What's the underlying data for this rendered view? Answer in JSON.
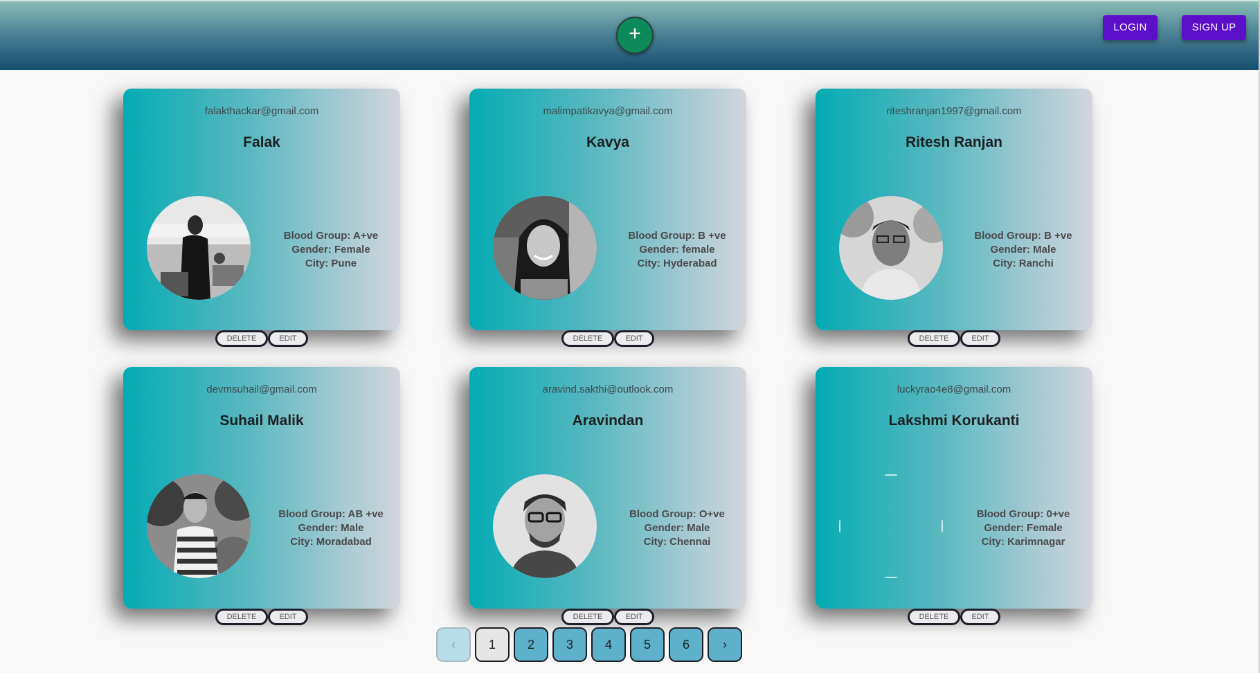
{
  "header": {
    "add_icon": "plus-icon",
    "add_label": "+",
    "login_label": "LOGIN",
    "signup_label": "SIGN UP",
    "colors": {
      "add": "#0d8a5c",
      "auth_buttons": "#5c0fc8"
    }
  },
  "cards": [
    {
      "email": "falakthackar@gmail.com",
      "name": "Falak",
      "blood_group": "Blood Group: A+ve",
      "gender": "Gender: Female",
      "city": "City: Pune",
      "photo": "person-photo",
      "delete_label": "DELETE",
      "edit_label": "EDIT"
    },
    {
      "email": "malimpatikavya@gmail.com",
      "name": "Kavya",
      "blood_group": "Blood Group: B +ve",
      "gender": "Gender: female",
      "city": "City: Hyderabad",
      "photo": "person-photo",
      "delete_label": "DELETE",
      "edit_label": "EDIT"
    },
    {
      "email": "riteshranjan1997@gmail.com",
      "name": "Ritesh Ranjan",
      "blood_group": "Blood Group: B +ve",
      "gender": "Gender: Male",
      "city": "City: Ranchi",
      "photo": "person-photo",
      "delete_label": "DELETE",
      "edit_label": "EDIT"
    },
    {
      "email": "devmsuhail@gmail.com",
      "name": "Suhail Malik",
      "blood_group": "Blood Group: AB +ve",
      "gender": "Gender: Male",
      "city": "City: Moradabad",
      "photo": "person-photo",
      "delete_label": "DELETE",
      "edit_label": "EDIT"
    },
    {
      "email": "aravind.sakthi@outlook.com",
      "name": "Aravindan",
      "blood_group": "Blood Group: O+ve",
      "gender": "Gender: Male",
      "city": "City: Chennai",
      "photo": "person-photo",
      "delete_label": "DELETE",
      "edit_label": "EDIT"
    },
    {
      "email": "luckyrao4e8@gmail.com",
      "name": "Lakshmi Korukanti",
      "blood_group": "Blood Group: 0+ve",
      "gender": "Gender: Female",
      "city": "City: Karimnagar",
      "photo": "broken-image",
      "delete_label": "DELETE",
      "edit_label": "EDIT"
    }
  ],
  "pagination": {
    "prev_icon": "chevron-left-icon",
    "prev_label": "‹",
    "pages": [
      "1",
      "2",
      "3",
      "4",
      "5",
      "6"
    ],
    "current_page": "1",
    "next_icon": "chevron-right-icon",
    "next_label": "›"
  }
}
